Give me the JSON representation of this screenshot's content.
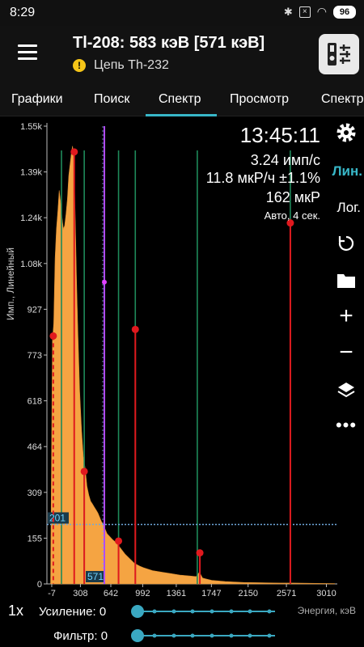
{
  "status": {
    "time": "8:29",
    "battery": "96",
    "sim": "×"
  },
  "appbar": {
    "title": "Tl-208: 583 кэВ [571 кэВ]",
    "subtitle": "Цепь Th-232",
    "warning": "!"
  },
  "tabs": [
    "Графики",
    "Поиск",
    "Спектр",
    "Просмотр",
    "Спектр"
  ],
  "active_tab": "Спектр",
  "info": {
    "time": "13:45:11",
    "rate": "3.24 имп/с",
    "dose_rate": "11.8 мкР/ч ±1.1%",
    "dose": "162 мкР",
    "mode": "Авто, 4 сек."
  },
  "side": {
    "lin": "Лин.",
    "log": "Лог."
  },
  "bottom": {
    "zoom": "1x",
    "gain_label": "Усиление: 0",
    "filter_label": "Фильтр: 0",
    "energy_label": "Энергия, кэВ"
  },
  "colors": {
    "accent": "#38b7c8",
    "spectrum": "#f5a442",
    "marker": "#e0191e",
    "peak_line": "#1e8a5a",
    "cursor": "#b04bff",
    "baseline": "#6fa8dc"
  },
  "chart_data": {
    "type": "area",
    "ylabel": "Имп., Линейный",
    "xlabel": "Энергия, кэВ",
    "y_ticks": [
      "1.55k",
      "1.39k",
      "1.24k",
      "1.08k",
      "927",
      "773",
      "618",
      "464",
      "309",
      "155",
      "0"
    ],
    "x_ticks": [
      "-7",
      "308",
      "642",
      "992",
      "1361",
      "1747",
      "2150",
      "2571",
      "3010"
    ],
    "x_tick_values": [
      -7,
      308,
      642,
      992,
      1361,
      1747,
      2150,
      2571,
      3010
    ],
    "ylim": [
      0,
      1547
    ],
    "xlim": [
      -60,
      3130
    ],
    "threshold": {
      "value": 201,
      "label": "201"
    },
    "cursor": {
      "energy": 571,
      "label": "571"
    },
    "spectrum": [
      [
        -20,
        0
      ],
      [
        0,
        820
      ],
      [
        15,
        880
      ],
      [
        30,
        1100
      ],
      [
        45,
        1200
      ],
      [
        60,
        1260
      ],
      [
        75,
        1330
      ],
      [
        90,
        1290
      ],
      [
        105,
        1240
      ],
      [
        120,
        1200
      ],
      [
        135,
        1210
      ],
      [
        150,
        1250
      ],
      [
        165,
        1300
      ],
      [
        180,
        1380
      ],
      [
        195,
        1420
      ],
      [
        210,
        1460
      ],
      [
        222,
        1480
      ],
      [
        235,
        1440
      ],
      [
        250,
        1250
      ],
      [
        265,
        1030
      ],
      [
        280,
        850
      ],
      [
        300,
        650
      ],
      [
        320,
        520
      ],
      [
        340,
        430
      ],
      [
        360,
        390
      ],
      [
        380,
        330
      ],
      [
        400,
        300
      ],
      [
        420,
        280
      ],
      [
        440,
        270
      ],
      [
        460,
        260
      ],
      [
        480,
        250
      ],
      [
        500,
        240
      ],
      [
        520,
        225
      ],
      [
        540,
        210
      ],
      [
        560,
        200
      ],
      [
        580,
        185
      ],
      [
        600,
        170
      ],
      [
        630,
        160
      ],
      [
        660,
        150
      ],
      [
        700,
        140
      ],
      [
        750,
        120
      ],
      [
        800,
        100
      ],
      [
        850,
        85
      ],
      [
        900,
        70
      ],
      [
        960,
        60
      ],
      [
        1000,
        55
      ],
      [
        1100,
        45
      ],
      [
        1200,
        40
      ],
      [
        1300,
        35
      ],
      [
        1400,
        30
      ],
      [
        1500,
        27
      ],
      [
        1580,
        25
      ],
      [
        1615,
        40
      ],
      [
        1650,
        20
      ],
      [
        1750,
        12
      ],
      [
        1900,
        8
      ],
      [
        2100,
        5
      ],
      [
        2300,
        4
      ],
      [
        2500,
        3
      ],
      [
        2650,
        3
      ],
      [
        2900,
        2
      ],
      [
        3100,
        1
      ]
    ],
    "peaks": [
      {
        "energy": 10,
        "count": 838,
        "dashed": true
      },
      {
        "energy": 240,
        "count": 1460,
        "dashed": false
      },
      {
        "energy": 350,
        "count": 380,
        "dashed": false
      },
      {
        "energy": 727,
        "count": 145,
        "dashed": false
      },
      {
        "energy": 911,
        "count": 860,
        "dashed": false
      },
      {
        "energy": 1620,
        "count": 105,
        "dashed": false
      },
      {
        "energy": 2614,
        "count": 1220,
        "dashed": false
      }
    ],
    "green_lines": [
      100,
      350,
      727,
      911,
      1592,
      2614
    ],
    "cursor_marker_count": 1020
  }
}
